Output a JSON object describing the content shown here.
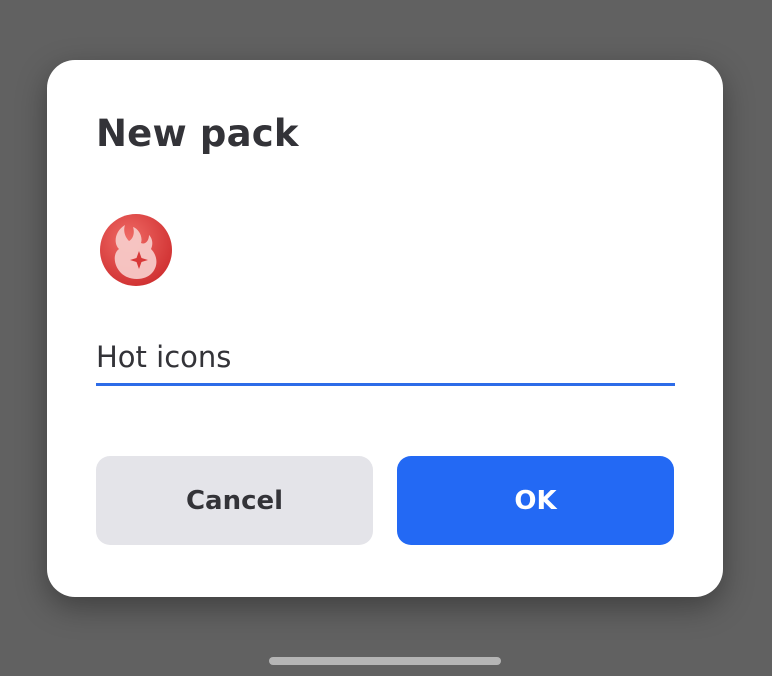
{
  "dialog": {
    "title": "New pack",
    "icon": "fire-sparkle-icon",
    "name_field": {
      "value": "Hot icons",
      "placeholder": ""
    },
    "buttons": {
      "cancel_label": "Cancel",
      "ok_label": "OK"
    }
  },
  "colors": {
    "scrim": "#616161",
    "dialog_background": "#ffffff",
    "accent": "#2369f4",
    "cancel_background": "#e4e4e9",
    "icon_red": "#d83838"
  }
}
